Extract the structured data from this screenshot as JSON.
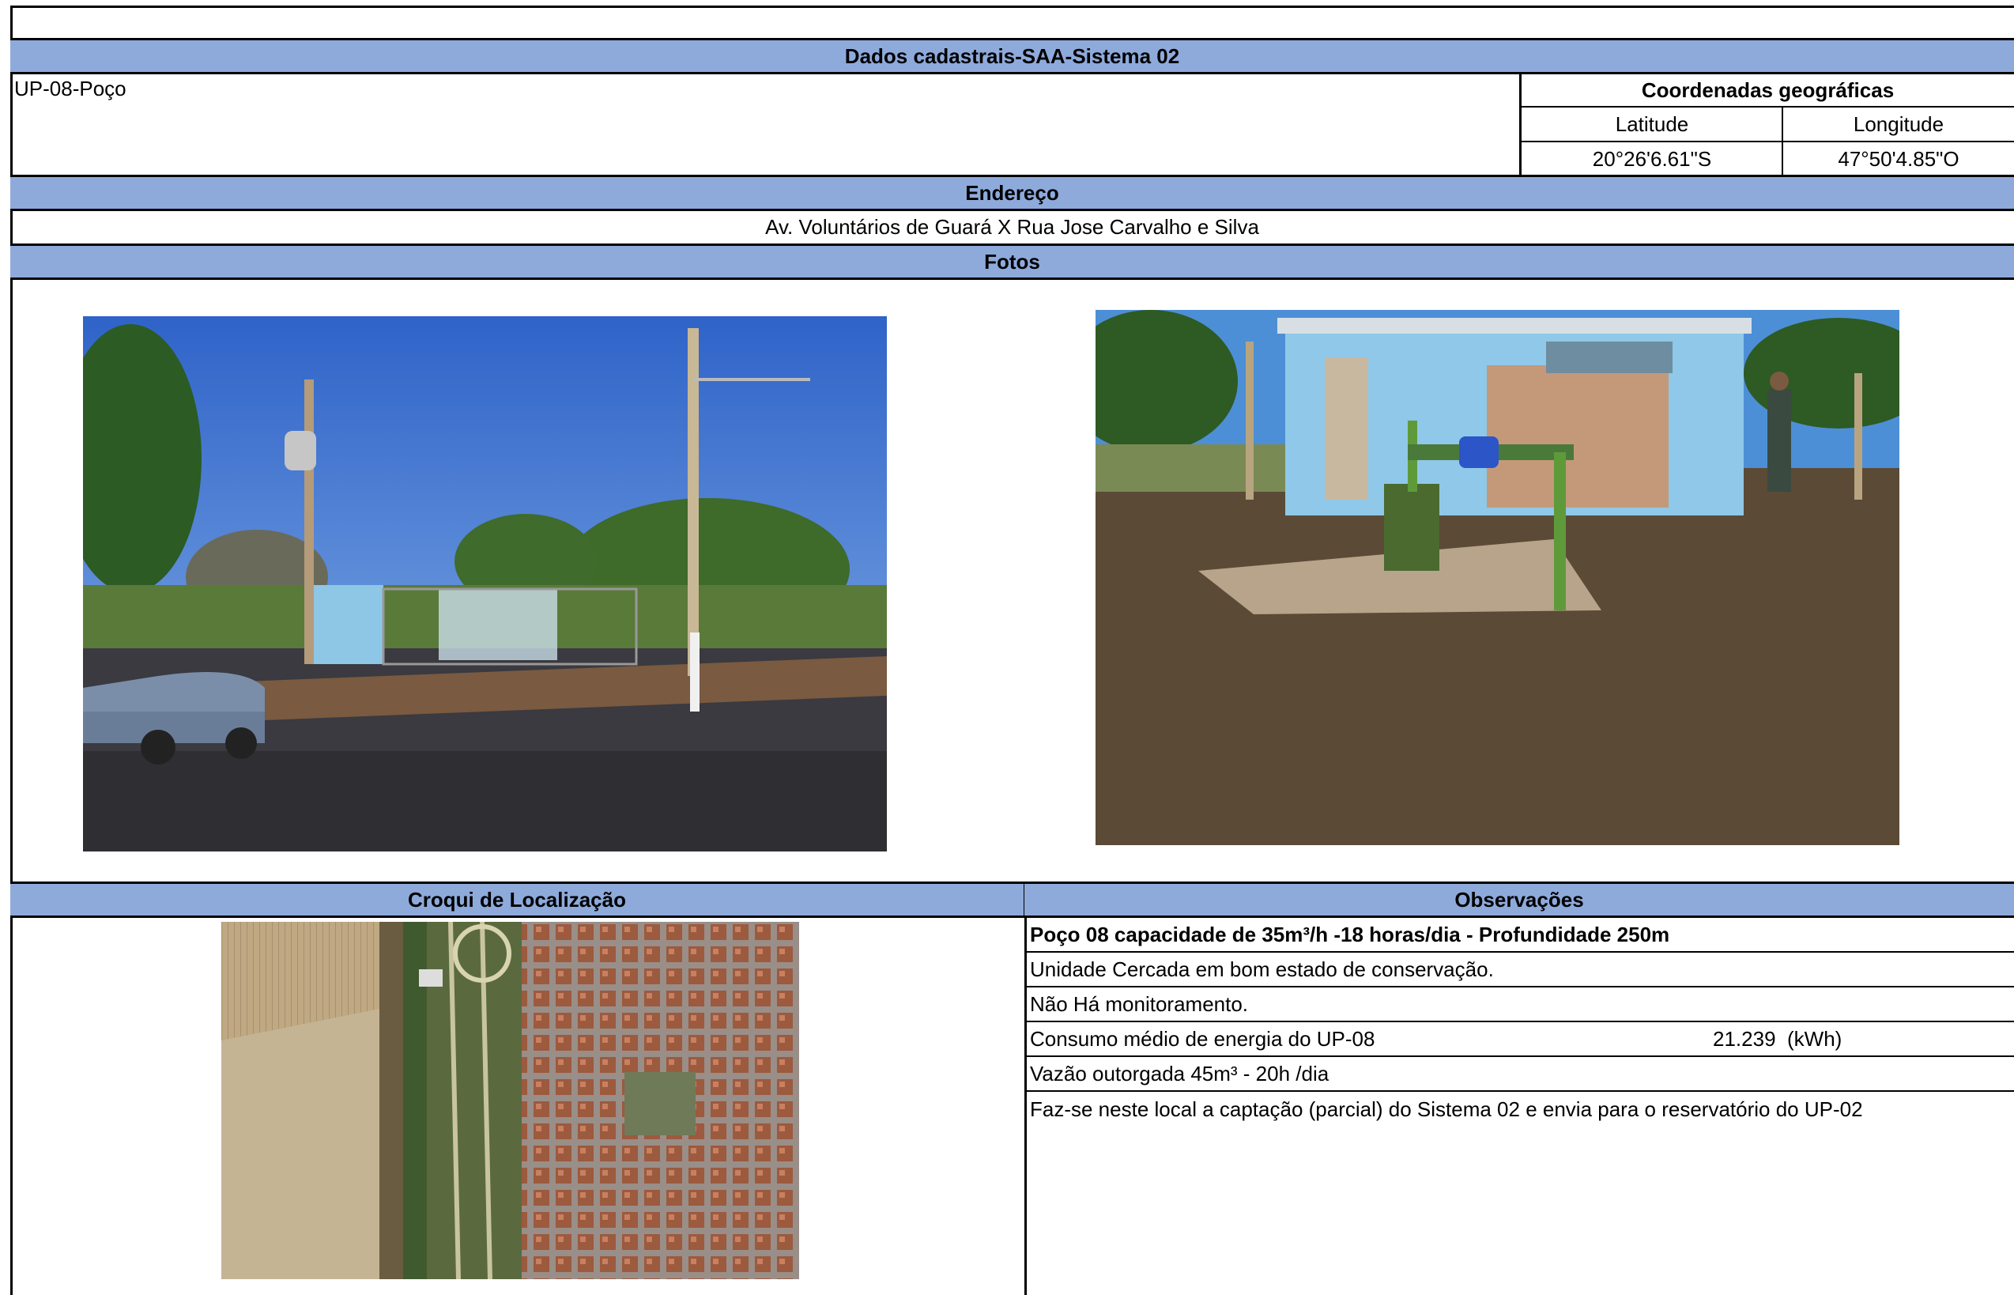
{
  "title": "Dados cadastrais-SAA-Sistema 02",
  "unit_name": "UP-08-Poço",
  "coords": {
    "heading": "Coordenadas geográficas",
    "lat_label": "Latitude",
    "lon_label": "Longitude",
    "lat_value": "20°26'6.61\"S",
    "lon_value": "47°50'4.85\"O"
  },
  "address": {
    "heading": "Endereço",
    "value": "Av. Voluntários de Guará X Rua Jose Carvalho e Silva"
  },
  "photos": {
    "heading": "Fotos"
  },
  "map": {
    "heading": "Croqui de Localização"
  },
  "observations": {
    "heading": "Observações",
    "lines": [
      "Poço 08 capacidade de 35m³/h -18 horas/dia - Profundidade 250m",
      "Unidade Cercada em bom estado de conservação.",
      "Não Há monitoramento.",
      "Consumo médio de energia do UP-08",
      "Vazão outorgada 45m³ - 20h /dia",
      "Faz-se neste local a captação (parcial) do Sistema 02 e envia para o reservatório do UP-02"
    ],
    "energy_value": "21.239",
    "energy_unit": "(kWh)"
  }
}
